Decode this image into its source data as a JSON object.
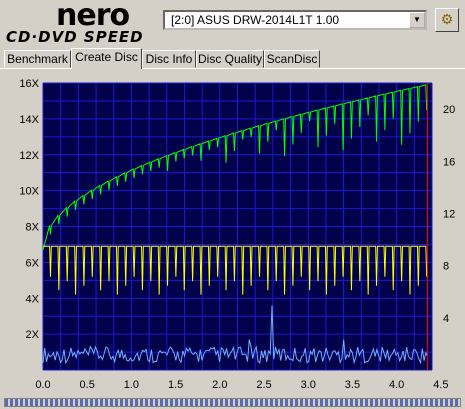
{
  "app": {
    "logo_top": "nero",
    "logo_bottom": "CD·DVD SPEED"
  },
  "drive": {
    "selected": "[2:0]  ASUS DRW-2014L1T 1.00"
  },
  "icons": {
    "dropdown": "chevron-down-icon",
    "config": "settings-icon"
  },
  "tabs": [
    {
      "label": "Benchmark",
      "active": false
    },
    {
      "label": "Create Disc",
      "active": true
    },
    {
      "label": "Disc Info",
      "active": false
    },
    {
      "label": "Disc Quality",
      "active": false
    },
    {
      "label": "ScanDisc",
      "active": false
    }
  ],
  "progress": {
    "fraction": 1.0
  },
  "colors": {
    "plot_bg": "#000040",
    "grid": "#1a1ad0",
    "speed": "#00ff00",
    "rpm": "#ffff00",
    "cpu": "#6fb0ff",
    "end_marker": "#ff0000"
  },
  "chart_data": {
    "type": "line",
    "x_range": [
      0,
      4.4
    ],
    "x_ticks": [
      "0.0",
      "0.5",
      "1.0",
      "1.5",
      "2.0",
      "2.5",
      "3.0",
      "3.5",
      "4.0",
      "4.5"
    ],
    "y_left_range": [
      0,
      16
    ],
    "y_left_ticks": [
      "2X",
      "4X",
      "6X",
      "8X",
      "10X",
      "12X",
      "14X",
      "16X"
    ],
    "y_right_range": [
      0,
      22
    ],
    "y_right_ticks": [
      "4",
      "8",
      "12",
      "16",
      "20"
    ],
    "end_x": 4.35,
    "grid": true,
    "series": [
      {
        "start": 6.7,
        "end": 15.9,
        "dip_to": 9.0,
        "dip_count": 46
      },
      {
        "level": 6.9,
        "dip_to": 5.2,
        "dip_count": 46
      },
      {
        "base": 0.4,
        "peak_max": 3.6
      }
    ]
  }
}
